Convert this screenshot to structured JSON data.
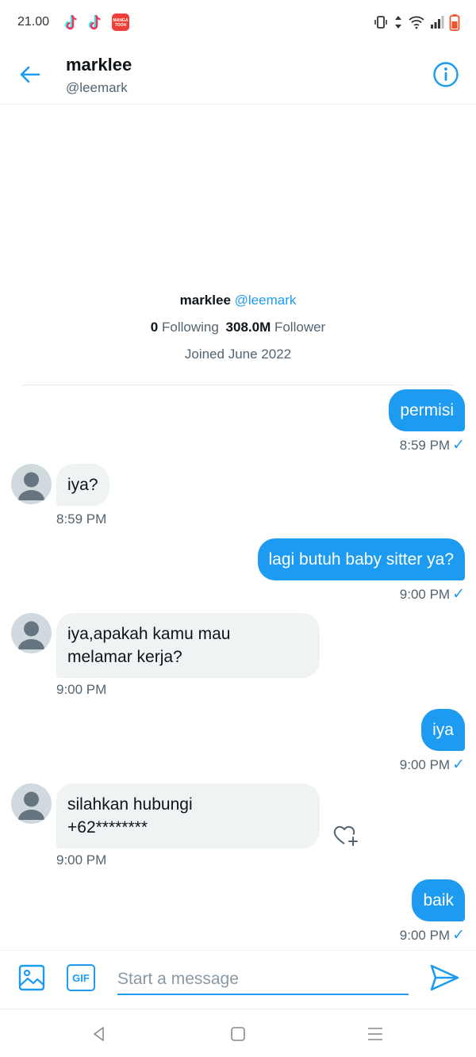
{
  "status_bar": {
    "time": "21.00",
    "apps": [
      "tiktok-icon",
      "tiktok-icon",
      "mangatoon-icon"
    ],
    "mangatoon_label_1": "MANGA",
    "mangatoon_label_2": "TOON"
  },
  "header": {
    "name": "marklee",
    "handle": "@leemark"
  },
  "profile": {
    "name": "marklee",
    "handle": "@leemark",
    "following_count": "0",
    "following_label": "Following",
    "follower_count": "308.0M",
    "follower_label": "Follower",
    "joined": "Joined June 2022"
  },
  "messages": [
    {
      "direction": "out",
      "text": "permisi",
      "time": "8:59 PM",
      "read": true
    },
    {
      "direction": "in",
      "text": "iya?",
      "time": "8:59 PM"
    },
    {
      "direction": "out",
      "text": "lagi butuh baby sitter ya?",
      "time": "9:00 PM",
      "read": true
    },
    {
      "direction": "in",
      "text_line1": "iya,apakah kamu mau",
      "text_line2": "melamar kerja?",
      "time": "9:00 PM"
    },
    {
      "direction": "out",
      "text": "iya",
      "time": "9:00 PM",
      "read": true
    },
    {
      "direction": "in",
      "text_line1": "silahkan hubungi",
      "text_line2": "+62********",
      "time": "9:00 PM"
    },
    {
      "direction": "out",
      "text": "baik",
      "time": "9:00 PM",
      "read": true
    }
  ],
  "read_mark": "✓",
  "composer": {
    "gif_label": "GIF",
    "placeholder": "Start a message"
  },
  "colors": {
    "accent": "#1d9bf0",
    "incoming_bubble": "#eff3f4",
    "secondary_text": "#536471"
  }
}
